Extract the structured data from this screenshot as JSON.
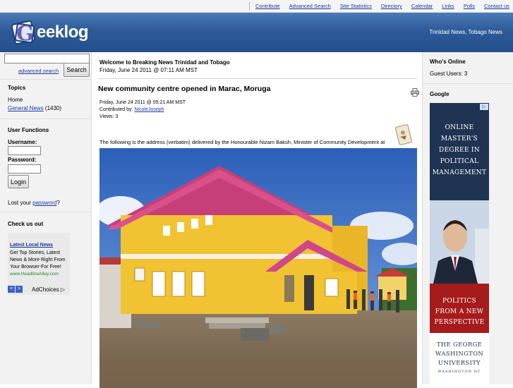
{
  "topnav": {
    "links": [
      "Contribute",
      "Advanced Search",
      "Site Statistics",
      "Directory",
      "Calendar",
      "Links",
      "Polls",
      "Contact us"
    ]
  },
  "header": {
    "logo_text": "Geeklog",
    "tagline": "Trinidad News, Tobago News"
  },
  "left": {
    "advanced_search": "advanced search",
    "search_button": "Search",
    "topics_heading": "Topics",
    "topic_home": "Home",
    "topic_general": "General News",
    "topic_general_count": "(1430)",
    "user_functions_heading": "User Functions",
    "username_label": "Username:",
    "password_label": "Password:",
    "login_button": "Login",
    "lost_password_prefix": "Lost your ",
    "lost_password_link": "password",
    "lost_password_suffix": "?",
    "check_us_out_heading": "Check us out",
    "ad": {
      "title": "Latest Local News",
      "body": "Get Top Stories, Latest News & More Right From Your Browser-For Free!",
      "url": "www.HeadlineAlley.com",
      "adchoices": "AdChoices"
    }
  },
  "center": {
    "welcome": "Welcome to Breaking News Trinidad and Tobago",
    "welcome_date": "Friday, June 24 2011 @ 07:11 AM MST",
    "story_title": "New community centre opened in Marac, Moruga",
    "story_date": "Friday, June 24 2011 @ 05:21 AM MST",
    "contributed_by_label": "Contributed by: ",
    "contributed_by": "NicoleJoseph",
    "views": "Views: 3",
    "intro": "The following is the address (verbatim) delivered by the Honourable Nizam Baksh, Minister of Community Development at"
  },
  "right": {
    "whos_online_heading": "Who's Online",
    "guest_users": "Guest Users: 3",
    "google_heading": "Google",
    "ad": {
      "line1": "ONLINE",
      "line2": "MASTER'S",
      "line3": "DEGREE IN",
      "line4": "POLITICAL",
      "line5": "MANAGEMENT",
      "line6": "POLITICS",
      "line7": "FROM A NEW",
      "line8": "PERSPECTIVE",
      "line9": "THE GEORGE",
      "line10": "WASHINGTON",
      "line11": "UNIVERSITY",
      "line12": "WASHINGTON DC"
    }
  },
  "colors": {
    "header_blue": "#2e5b98",
    "link_blue": "#1a3a9c",
    "building_yellow": "#f1c232",
    "roof_pink": "#d23b7a"
  }
}
